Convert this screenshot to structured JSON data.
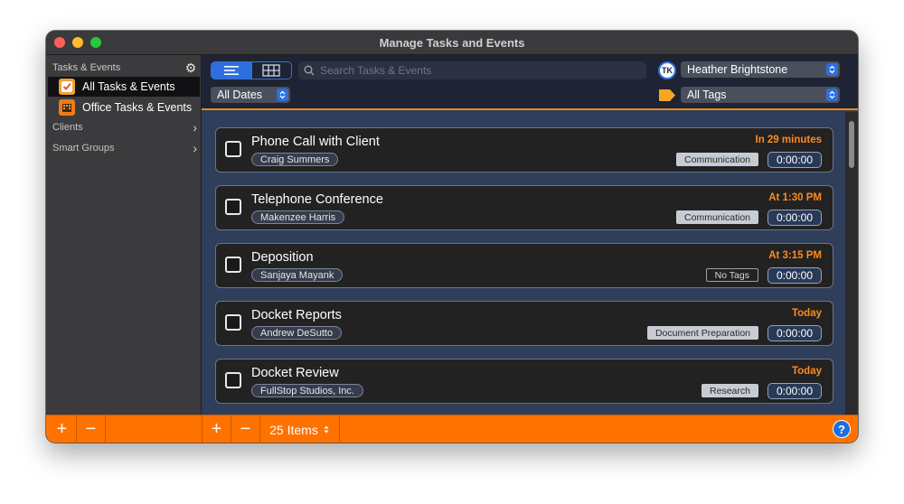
{
  "window": {
    "title": "Manage Tasks and Events"
  },
  "sidebar": {
    "header": "Tasks & Events",
    "items": [
      {
        "label": "All Tasks & Events",
        "icon": "checkmark-icon"
      },
      {
        "label": "Office Tasks & Events",
        "icon": "office-icon"
      }
    ],
    "groups": [
      {
        "label": "Clients"
      },
      {
        "label": "Smart Groups"
      }
    ]
  },
  "toolbar": {
    "search_placeholder": "Search Tasks & Events",
    "user": "Heather Brightstone",
    "user_badge": "TK",
    "dates_filter": "All Dates",
    "tags_filter": "All Tags"
  },
  "tasks": [
    {
      "title": "Phone Call with Client",
      "person": "Craig Summers",
      "due": "In 29 minutes",
      "tag": "Communication",
      "timer": "0:00:00"
    },
    {
      "title": "Telephone Conference",
      "person": "Makenzee Harris",
      "due": "At 1:30 PM",
      "tag": "Communication",
      "timer": "0:00:00"
    },
    {
      "title": "Deposition",
      "person": "Sanjaya Mayank",
      "due": "At 3:15 PM",
      "tag": "No Tags",
      "timer": "0:00:00"
    },
    {
      "title": "Docket Reports",
      "person": "Andrew DeSutto",
      "due": "Today",
      "tag": "Document Preparation",
      "timer": "0:00:00"
    },
    {
      "title": "Docket Review",
      "person": "FullStop Studios, Inc.",
      "due": "Today",
      "tag": "Research",
      "timer": "0:00:00"
    }
  ],
  "bottombar": {
    "add_label": "+",
    "remove_label": "−",
    "items_count": "25 Items",
    "help_label": "?"
  },
  "colors": {
    "accent": "#ff7200",
    "due_text": "#ff8a1e",
    "selection_blue": "#2e6fe0"
  }
}
